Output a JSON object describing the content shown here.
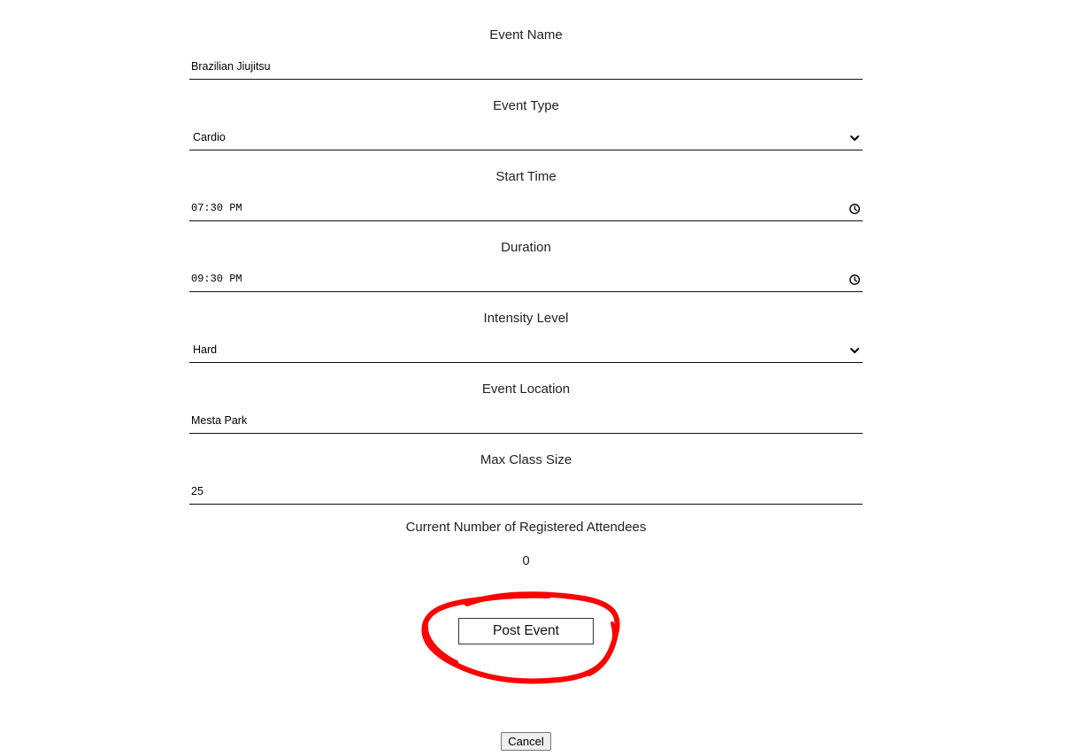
{
  "form": {
    "fields": [
      {
        "label": "Event Name",
        "value": "Brazilian Jiujitsu",
        "kind": "text"
      },
      {
        "label": "Event Type",
        "value": "Cardio",
        "kind": "select",
        "icon": "chevron-down-icon"
      },
      {
        "label": "Start Time",
        "value": "07:30 PM",
        "kind": "time",
        "icon": "clock-icon"
      },
      {
        "label": "Duration",
        "value": "09:30 PM",
        "kind": "time",
        "icon": "clock-icon"
      },
      {
        "label": "Intensity Level",
        "value": "Hard",
        "kind": "select",
        "icon": "chevron-down-icon"
      },
      {
        "label": "Event Location",
        "value": "Mesta Park",
        "kind": "text"
      },
      {
        "label": "Max Class Size",
        "value": "25",
        "kind": "text"
      }
    ],
    "attendees": {
      "label": "Current Number of Registered Attendees",
      "value": "0"
    }
  },
  "actions": {
    "post_label": "Post Event",
    "cancel_label": "Cancel"
  },
  "annotation": {
    "color": "#ff0000"
  }
}
